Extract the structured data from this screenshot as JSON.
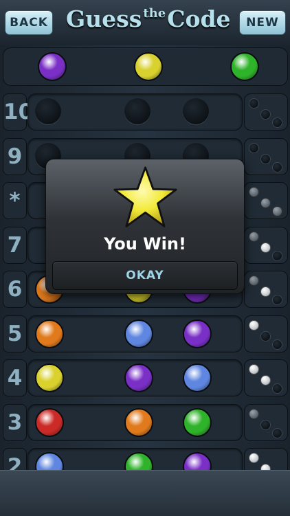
{
  "header": {
    "back_label": "BACK",
    "new_label": "NEW",
    "title_left": "Guess",
    "title_super": "the",
    "title_right": "Code"
  },
  "colors": {
    "purple": "#7a2fc7",
    "yellow": "#d9d12e",
    "green": "#2fb32a",
    "orange": "#e07a1c",
    "blue": "#5f86e0",
    "red": "#cc2a26",
    "empty": "#000000"
  },
  "secret": [
    "purple",
    "yellow",
    "green"
  ],
  "rows": [
    {
      "label": "10",
      "pegs": [
        "empty",
        "empty",
        "empty"
      ],
      "keys": [
        "empty",
        "empty",
        "empty"
      ]
    },
    {
      "label": "9",
      "pegs": [
        "empty",
        "empty",
        "empty"
      ],
      "keys": [
        "empty",
        "empty",
        "empty"
      ]
    },
    {
      "label": "*",
      "pegs": [
        "hidden",
        "hidden",
        "hidden"
      ],
      "keys": [
        "gray",
        "gray",
        "gray"
      ]
    },
    {
      "label": "7",
      "pegs": [
        "hidden",
        "hidden",
        "hidden"
      ],
      "keys": [
        "gray",
        "white",
        "empty"
      ]
    },
    {
      "label": "6",
      "pegs": [
        "orange",
        "yellow",
        "purple"
      ],
      "keys": [
        "gray",
        "white",
        "empty"
      ]
    },
    {
      "label": "5",
      "pegs": [
        "orange",
        "blue",
        "purple"
      ],
      "keys": [
        "white",
        "empty",
        "empty"
      ]
    },
    {
      "label": "4",
      "pegs": [
        "yellow",
        "purple",
        "blue"
      ],
      "keys": [
        "white",
        "white",
        "empty"
      ]
    },
    {
      "label": "3",
      "pegs": [
        "red",
        "orange",
        "green"
      ],
      "keys": [
        "gray",
        "empty",
        "empty"
      ]
    },
    {
      "label": "2",
      "pegs": [
        "blue",
        "green",
        "purple"
      ],
      "keys": [
        "white",
        "white",
        "empty"
      ]
    }
  ],
  "dialog": {
    "message": "You Win!",
    "okay_label": "OKAY",
    "icon": "star-icon"
  }
}
